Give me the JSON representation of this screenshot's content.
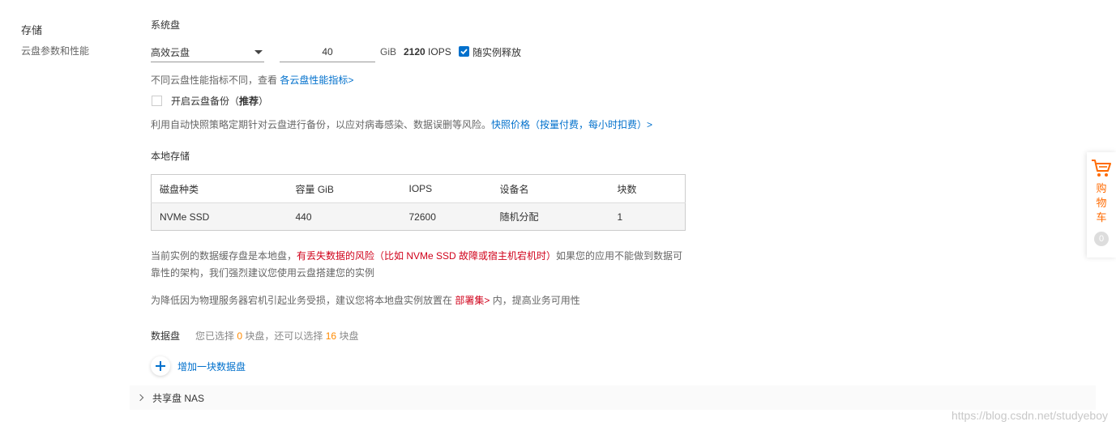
{
  "section": {
    "title": "存储",
    "subtitle": "云盘参数和性能"
  },
  "system_disk": {
    "title": "系统盘",
    "type_selected": "高效云盘",
    "size_value": "40",
    "unit": "GiB",
    "iops_value": "2120",
    "iops_label": "IOPS",
    "release_label": "随实例释放",
    "release_checked": true,
    "perf_text": "不同云盘性能指标不同，查看",
    "perf_link": "各云盘性能指标>"
  },
  "backup": {
    "label_prefix": "开启云盘备份（",
    "label_bold": "推荐",
    "label_suffix": "）",
    "checked": false,
    "desc": "利用自动快照策略定期针对云盘进行备份，以应对病毒感染、数据误删等风险。",
    "desc_link": "快照价格（按量付费，每小时扣费）>"
  },
  "local_storage": {
    "title": "本地存储",
    "columns": [
      "磁盘种类",
      "容量 GiB",
      "IOPS",
      "设备名",
      "块数"
    ],
    "rows": [
      [
        "NVMe SSD",
        "440",
        "72600",
        "随机分配",
        "1"
      ]
    ]
  },
  "warnings": {
    "w1_a": "当前实例的数据缓存盘是本地盘，",
    "w1_red": "有丢失数据的风险（比如 NVMe SSD 故障或宿主机宕机时）",
    "w1_b": "如果您的应用不能做到数据可靠性的架构，我们强烈建议您使用云盘搭建您的实例",
    "w2_a": "为降低因为物理服务器宕机引起业务受损，建议您将本地盘实例放置在",
    "w2_link": "部署集>",
    "w2_b": "内，提高业务可用性"
  },
  "data_disk": {
    "title": "数据盘",
    "note_a": "您已选择",
    "selected": "0",
    "note_b": "块盘，还可以选择",
    "remaining": "16",
    "note_c": "块盘",
    "add_label": "增加一块数据盘"
  },
  "nas": {
    "label": "共享盘 NAS"
  },
  "cart": {
    "label": "购物车",
    "count": "0",
    "accent": "#ff6a00"
  },
  "watermark": "https://blog.csdn.net/studyeboy",
  "colors": {
    "link": "#0070cc",
    "warning": "#d0021b",
    "highlight": "#ff8a00"
  }
}
